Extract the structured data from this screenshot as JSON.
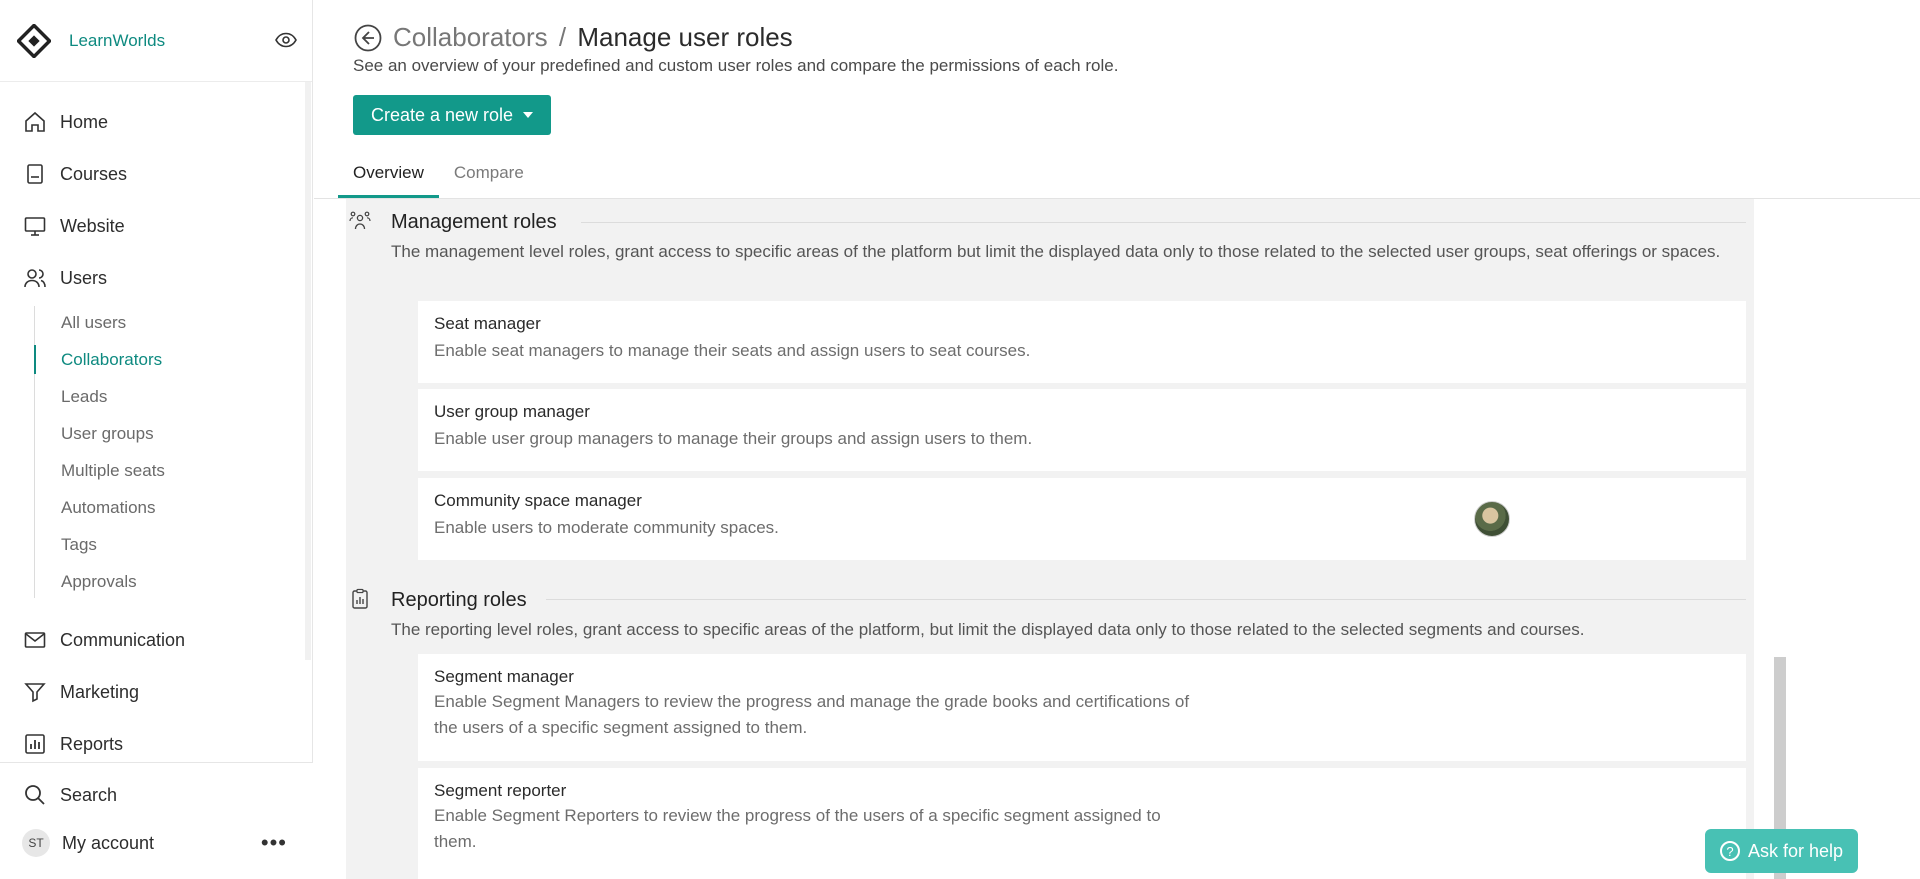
{
  "brand": {
    "name": "LearnWorlds"
  },
  "sidebar": {
    "items": [
      {
        "label": "Home",
        "icon": "home-icon"
      },
      {
        "label": "Courses",
        "icon": "book-icon"
      },
      {
        "label": "Website",
        "icon": "monitor-icon"
      },
      {
        "label": "Users",
        "icon": "users-icon"
      }
    ],
    "users_sub": [
      {
        "label": "All users"
      },
      {
        "label": "Collaborators",
        "active": true
      },
      {
        "label": "Leads"
      },
      {
        "label": "User groups"
      },
      {
        "label": "Multiple seats"
      },
      {
        "label": "Automations"
      },
      {
        "label": "Tags"
      },
      {
        "label": "Approvals"
      }
    ],
    "items_after": [
      {
        "label": "Communication",
        "icon": "mail-icon"
      },
      {
        "label": "Marketing",
        "icon": "funnel-icon"
      },
      {
        "label": "Reports",
        "icon": "reports-icon"
      }
    ],
    "search_label": "Search",
    "account_initials": "ST",
    "account_label": "My account",
    "more_label": "•••"
  },
  "header": {
    "crumb": "Collaborators",
    "separator": "/",
    "title": "Manage user roles",
    "subtitle": "See an overview of your predefined and custom user roles and compare the permissions of each role.",
    "create_button": "Create a new role",
    "tabs": [
      {
        "label": "Overview",
        "active": true
      },
      {
        "label": "Compare",
        "active": false
      }
    ]
  },
  "sections": {
    "management": {
      "title": "Management roles",
      "description": "The management level roles, grant access to specific areas of the platform but limit the displayed data only to those related to the selected user groups, seat offerings or spaces.",
      "roles": [
        {
          "title": "Seat manager",
          "description": "Enable seat managers to manage their seats and assign users to seat courses."
        },
        {
          "title": "User group manager",
          "description": "Enable user group managers to manage their groups and assign users to them."
        },
        {
          "title": "Community space manager",
          "description": "Enable users to moderate community spaces."
        }
      ]
    },
    "reporting": {
      "title": "Reporting roles",
      "description": "The reporting level roles, grant access to specific areas of the platform, but limit the displayed data only to those related to the selected segments and courses.",
      "roles": [
        {
          "title": "Segment manager",
          "description_lines": [
            "Enable Segment Managers to review the progress and manage the grade books and certifications of",
            "the users of a specific segment assigned to them."
          ]
        },
        {
          "title": "Segment reporter",
          "description_lines": [
            "Enable Segment Reporters to review the progress of the users of a specific segment assigned to",
            "them."
          ]
        }
      ]
    }
  },
  "help": {
    "label": "Ask for help"
  },
  "colors": {
    "accent": "#12998a",
    "help": "#48c1b4",
    "active_link": "#0e8a80"
  }
}
